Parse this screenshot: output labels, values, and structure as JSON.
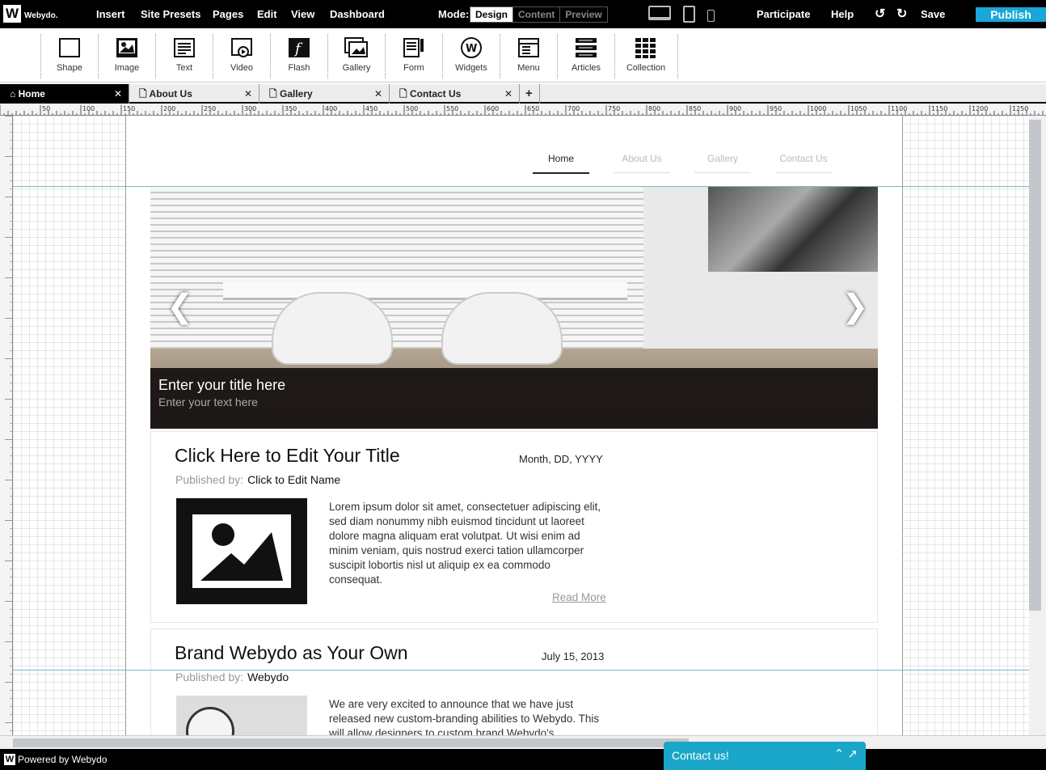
{
  "brand": {
    "logo_letter": "W",
    "logo_text": "Webydo."
  },
  "menu": [
    "Insert",
    "Site Presets",
    "Pages",
    "Edit",
    "View",
    "Dashboard"
  ],
  "mode": {
    "label": "Mode:",
    "options": [
      "Design",
      "Content",
      "Preview"
    ],
    "selected": "Design"
  },
  "top_right": {
    "participate": "Participate",
    "help": "Help",
    "save": "Save",
    "publish": "Publish"
  },
  "tools": [
    "Shape",
    "Image",
    "Text",
    "Video",
    "Flash",
    "Gallery",
    "Form",
    "Widgets",
    "Menu",
    "Articles",
    "Collection"
  ],
  "tabs": [
    "Home",
    "About Us",
    "Gallery",
    "Contact Us"
  ],
  "active_tab": "Home",
  "ruler_ticks": [
    "50",
    "100",
    "150",
    "200",
    "250",
    "300",
    "350",
    "400",
    "450",
    "500",
    "550",
    "600",
    "650",
    "700",
    "750",
    "800",
    "850",
    "900",
    "950",
    "1000",
    "1050",
    "1100",
    "1150",
    "1200",
    "1250"
  ],
  "site_nav": [
    "Home",
    "About Us",
    "Gallery",
    "Contact Us"
  ],
  "slider": {
    "title": "Enter your title here",
    "text": "Enter your text here"
  },
  "posts": [
    {
      "title": "Click Here to Edit Your Title",
      "date": "Month, DD, YYYY",
      "by_label": "Published by:",
      "by_name": "Click to Edit Name",
      "body": "Lorem ipsum dolor sit amet, consectetuer adipiscing elit, sed diam nonummy nibh euismod tincidunt ut laoreet dolore magna aliquam erat volutpat. Ut wisi enim ad minim veniam, quis nostrud exerci tation ullamcorper suscipit lobortis nisl ut aliquip ex ea commodo consequat.",
      "read_more": "Read More"
    },
    {
      "title": "Brand Webydo as Your Own",
      "date": "July 15, 2013",
      "by_label": "Published by:",
      "by_name": "Webydo",
      "body": "We are very excited to announce that we have just released new custom-branding abilities to Webydo. This will allow designers to custom brand Webydo's"
    }
  ],
  "footer": {
    "text": "Powered by Webydo",
    "logo_letter": "W"
  },
  "contact_widget": {
    "label": "Contact us!"
  },
  "colors": {
    "accent": "#1aa6d6",
    "topbar": "#000000"
  }
}
